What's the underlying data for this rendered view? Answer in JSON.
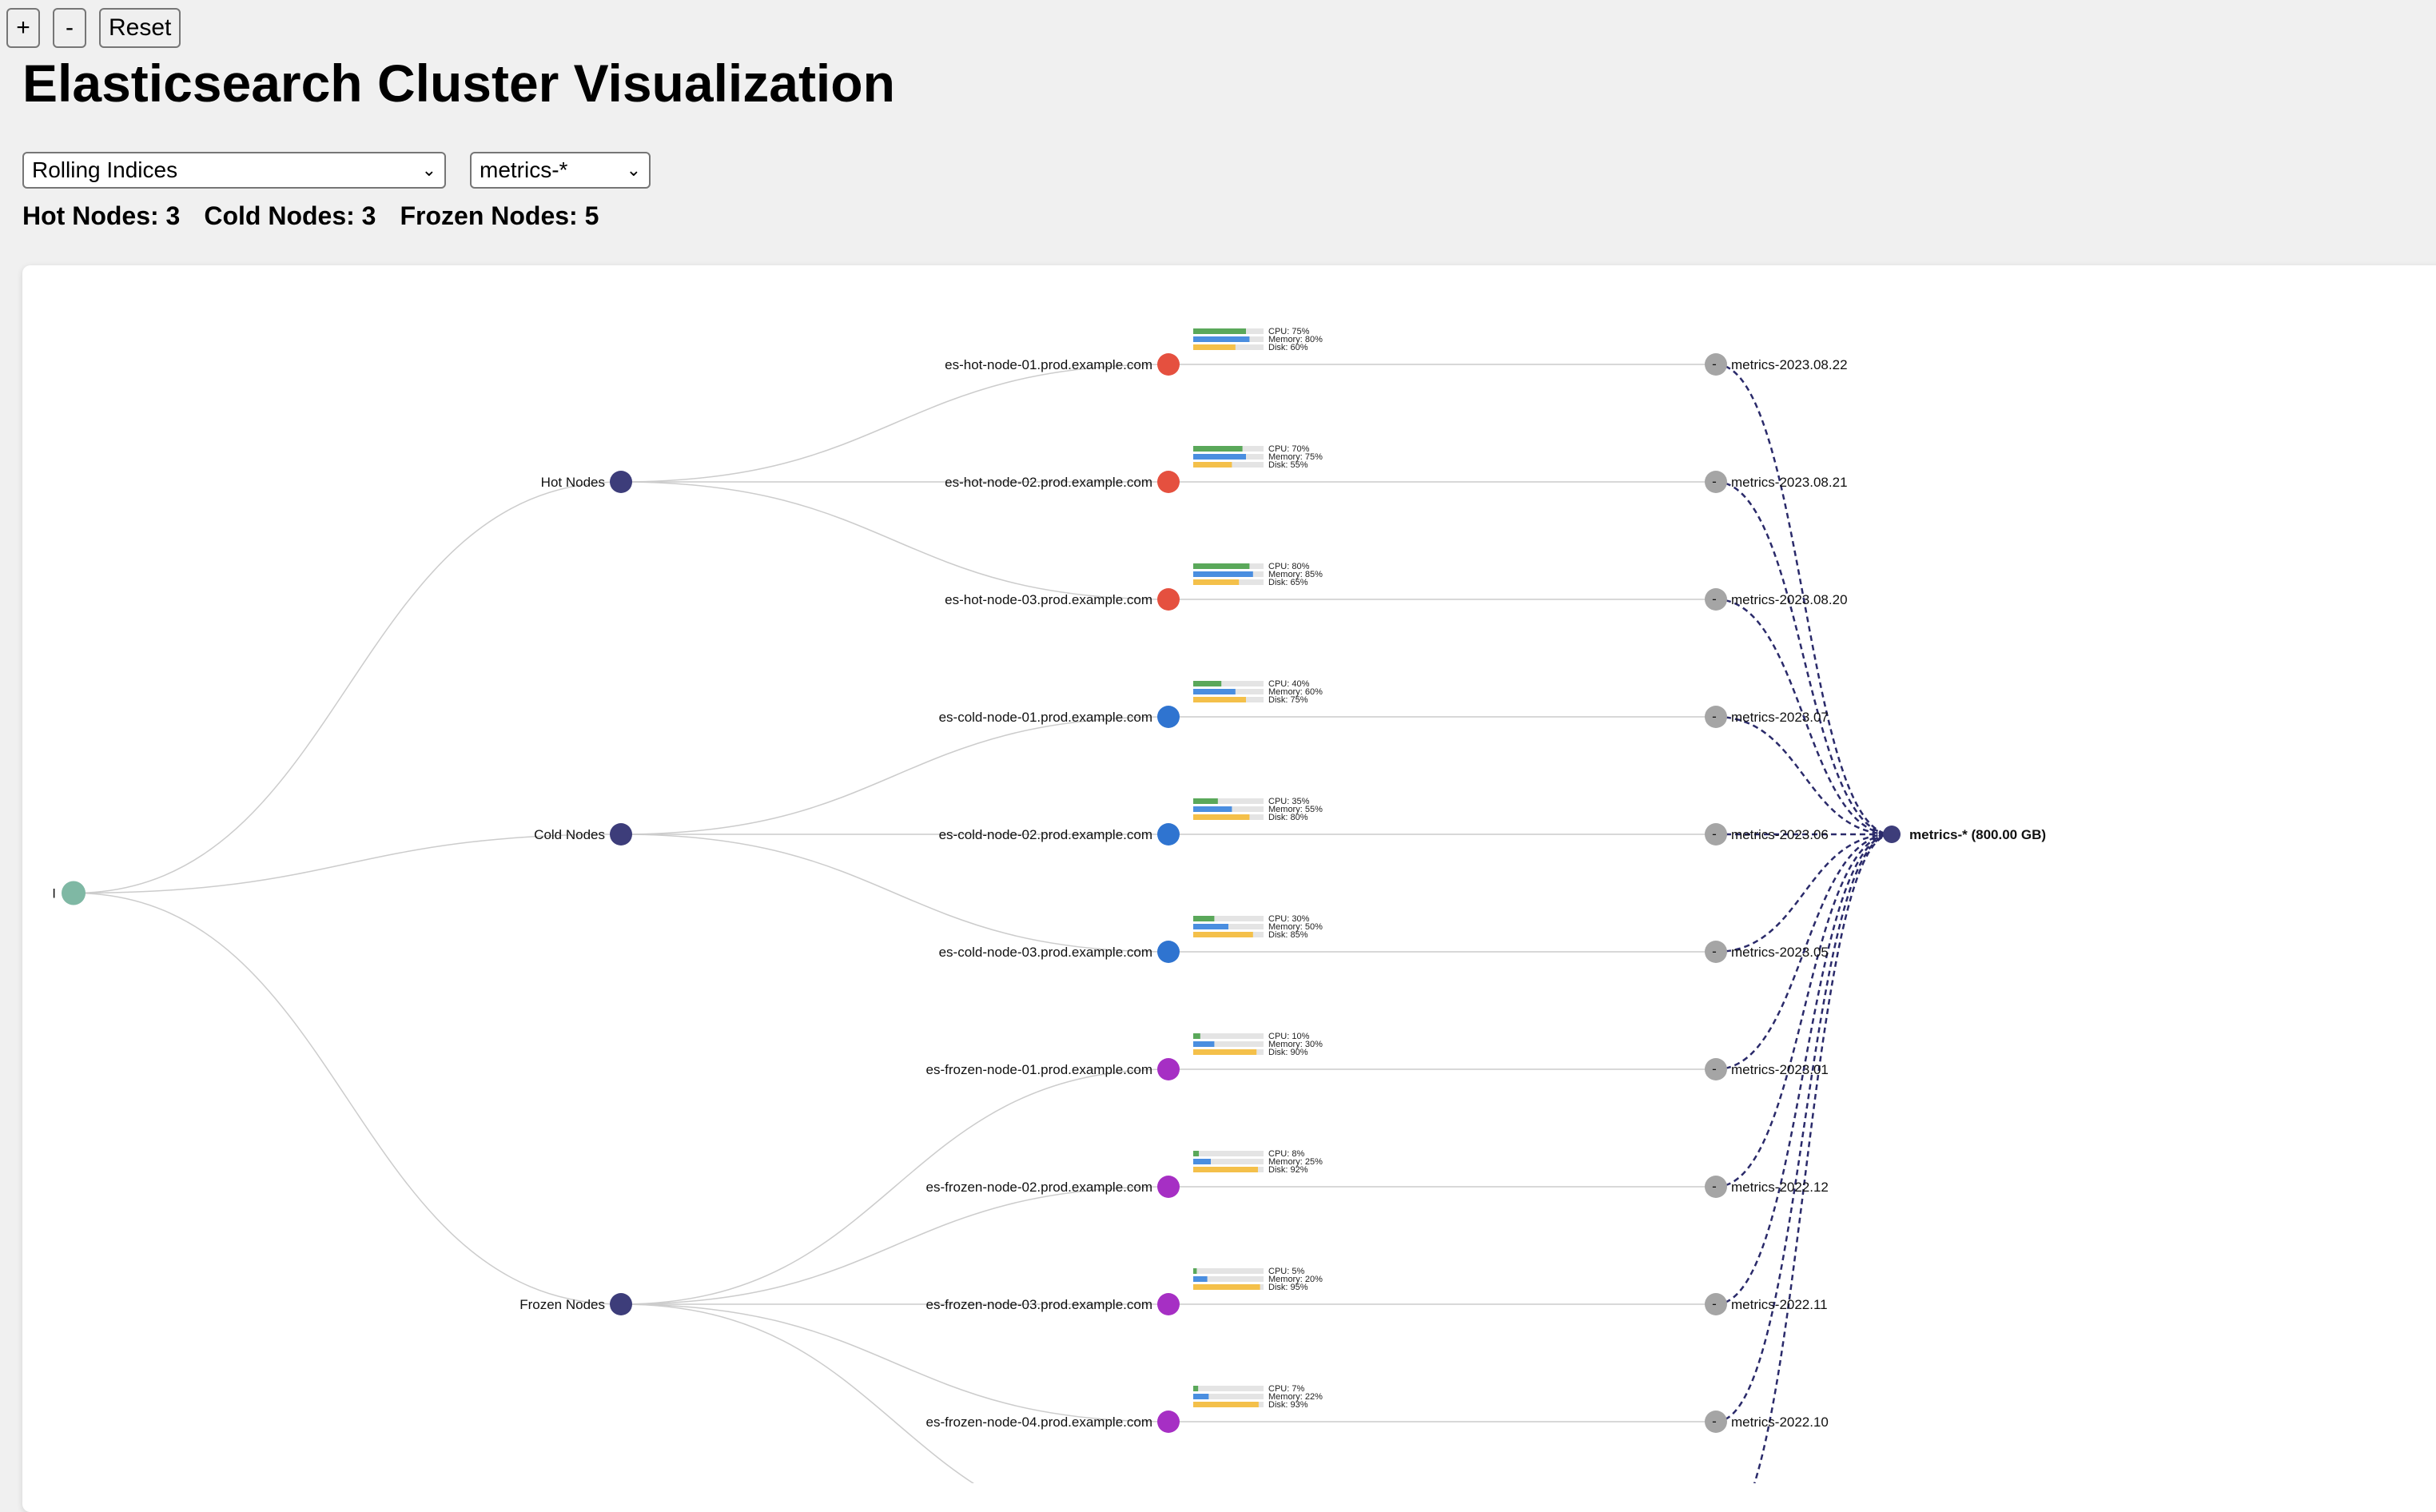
{
  "zoom": {
    "in_label": "+",
    "out_label": "-",
    "reset_label": "Reset"
  },
  "title": "Elasticsearch Cluster Visualization",
  "view_select": {
    "value": "Rolling Indices"
  },
  "pattern_select": {
    "value": "metrics-*"
  },
  "counts": {
    "hot": "Hot Nodes: 3",
    "cold": "Cold Nodes: 3",
    "frozen": "Frozen Nodes: 5"
  },
  "colors": {
    "root": "#7fb8a4",
    "tier": "#3d3d7a",
    "hot": "#e5503f",
    "cold": "#2f74d0",
    "frozen": "#a62fc4",
    "index": "#a5a5a5",
    "link": "#cccccc",
    "dashed": "#2a2a6a",
    "cpu": "#5aa85a",
    "memory": "#4a8ee0",
    "disk": "#f4c04a",
    "barbg": "#e4e4e4"
  },
  "tree": {
    "root_label": "I",
    "tiers": [
      {
        "label": "Hot Nodes",
        "type": "hot"
      },
      {
        "label": "Cold Nodes",
        "type": "cold"
      },
      {
        "label": "Frozen Nodes",
        "type": "frozen"
      }
    ],
    "nodes": [
      {
        "name": "es-hot-node-01.prod.example.com",
        "tier": 0,
        "type": "hot",
        "cpu": 75,
        "memory": 80,
        "disk": 60,
        "cpu_label": "CPU: 75%",
        "memory_label": "Memory: 80%",
        "disk_label": "Disk: 60%"
      },
      {
        "name": "es-hot-node-02.prod.example.com",
        "tier": 0,
        "type": "hot",
        "cpu": 70,
        "memory": 75,
        "disk": 55,
        "cpu_label": "CPU: 70%",
        "memory_label": "Memory: 75%",
        "disk_label": "Disk: 55%"
      },
      {
        "name": "es-hot-node-03.prod.example.com",
        "tier": 0,
        "type": "hot",
        "cpu": 80,
        "memory": 85,
        "disk": 65,
        "cpu_label": "CPU: 80%",
        "memory_label": "Memory: 85%",
        "disk_label": "Disk: 65%"
      },
      {
        "name": "es-cold-node-01.prod.example.com",
        "tier": 1,
        "type": "cold",
        "cpu": 40,
        "memory": 60,
        "disk": 75,
        "cpu_label": "CPU: 40%",
        "memory_label": "Memory: 60%",
        "disk_label": "Disk: 75%"
      },
      {
        "name": "es-cold-node-02.prod.example.com",
        "tier": 1,
        "type": "cold",
        "cpu": 35,
        "memory": 55,
        "disk": 80,
        "cpu_label": "CPU: 35%",
        "memory_label": "Memory: 55%",
        "disk_label": "Disk: 80%"
      },
      {
        "name": "es-cold-node-03.prod.example.com",
        "tier": 1,
        "type": "cold",
        "cpu": 30,
        "memory": 50,
        "disk": 85,
        "cpu_label": "CPU: 30%",
        "memory_label": "Memory: 50%",
        "disk_label": "Disk: 85%"
      },
      {
        "name": "es-frozen-node-01.prod.example.com",
        "tier": 2,
        "type": "frozen",
        "cpu": 10,
        "memory": 30,
        "disk": 90,
        "cpu_label": "CPU: 10%",
        "memory_label": "Memory: 30%",
        "disk_label": "Disk: 90%"
      },
      {
        "name": "es-frozen-node-02.prod.example.com",
        "tier": 2,
        "type": "frozen",
        "cpu": 8,
        "memory": 25,
        "disk": 92,
        "cpu_label": "CPU: 8%",
        "memory_label": "Memory: 25%",
        "disk_label": "Disk: 92%"
      },
      {
        "name": "es-frozen-node-03.prod.example.com",
        "tier": 2,
        "type": "frozen",
        "cpu": 5,
        "memory": 20,
        "disk": 95,
        "cpu_label": "CPU: 5%",
        "memory_label": "Memory: 20%",
        "disk_label": "Disk: 95%"
      },
      {
        "name": "es-frozen-node-04.prod.example.com",
        "tier": 2,
        "type": "frozen",
        "cpu": 7,
        "memory": 22,
        "disk": 93,
        "cpu_label": "CPU: 7%",
        "memory_label": "Memory: 22%",
        "disk_label": "Disk: 93%"
      }
    ],
    "indices": [
      "metrics-2023.08.22",
      "metrics-2023.08.21",
      "metrics-2023.08.20",
      "metrics-2023.07",
      "metrics-2023.06",
      "metrics-2023.05",
      "metrics-2023.01",
      "metrics-2022.12",
      "metrics-2022.11",
      "metrics-2022.10"
    ],
    "index_dot_label": "-",
    "target_label": "metrics-* (800.00 GB)"
  }
}
